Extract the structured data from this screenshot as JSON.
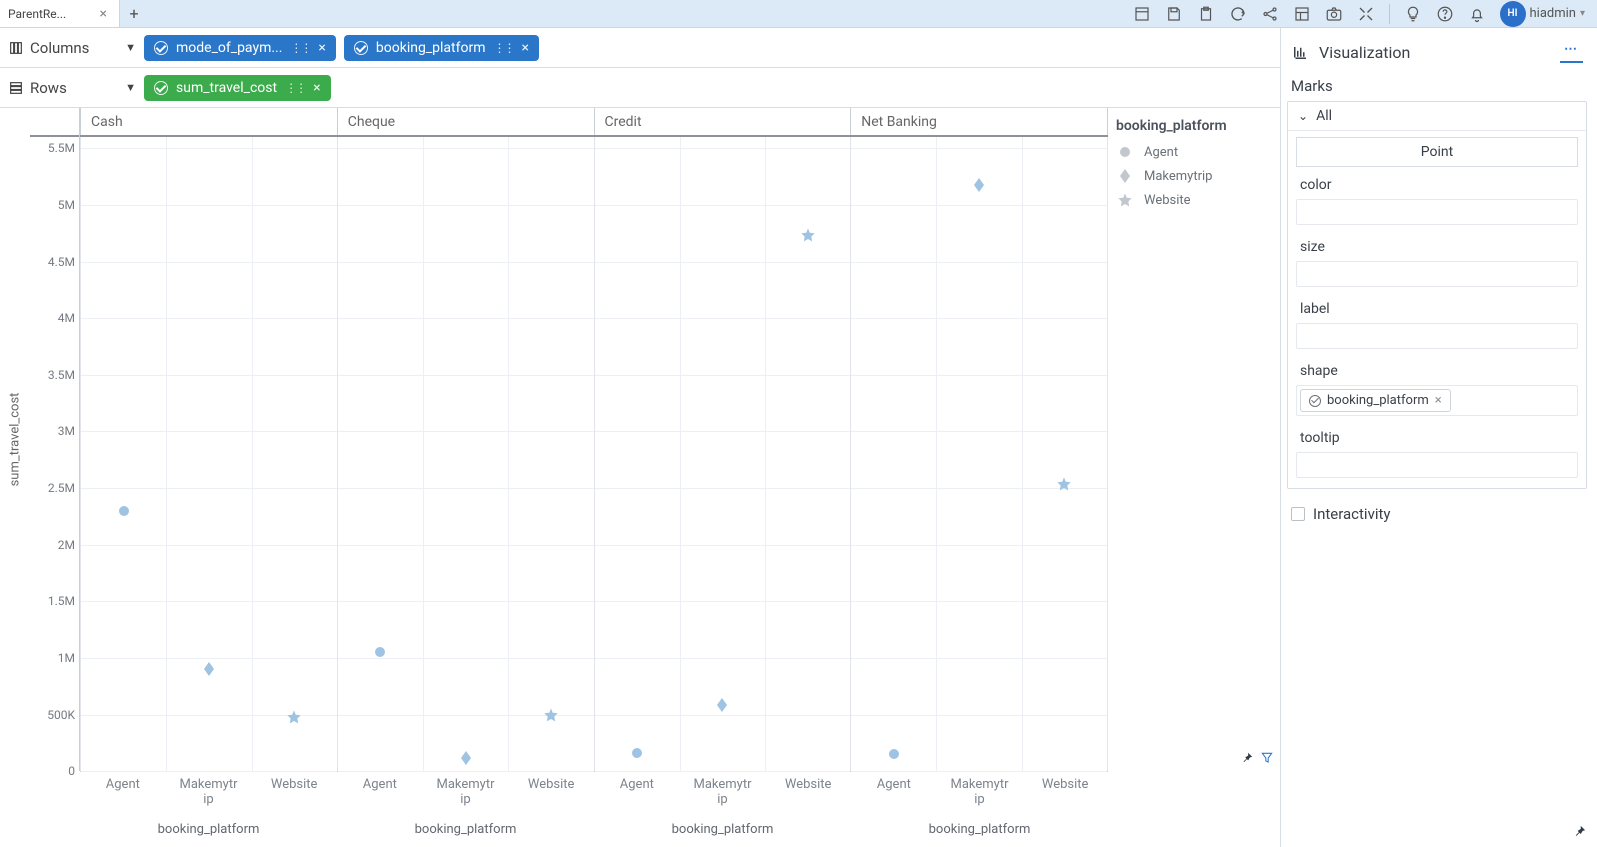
{
  "tab_title": "ParentRe...",
  "user_name": "hiadmin",
  "avatar_text": "HI",
  "shelves": {
    "columns_label": "Columns",
    "rows_label": "Rows",
    "col_pills": [
      {
        "label": "mode_of_paym..."
      },
      {
        "label": "booking_platform"
      }
    ],
    "row_pills": [
      {
        "label": "sum_travel_cost"
      }
    ]
  },
  "right": {
    "title": "Visualization",
    "marks": "Marks",
    "all": "All",
    "mark_type": "Point",
    "props": {
      "color": "color",
      "size": "size",
      "label": "label",
      "shape": "shape",
      "tooltip": "tooltip"
    },
    "shape_chip": "booking_platform",
    "interactivity": "Interactivity"
  },
  "legend": {
    "title": "booking_platform",
    "items": [
      "Agent",
      "Makemytrip",
      "Website"
    ]
  },
  "chart_data": {
    "type": "scatter",
    "ylabel": "sum_travel_cost",
    "ylim": [
      0,
      5600000
    ],
    "yticks": [
      0,
      500000,
      1000000,
      1500000,
      2000000,
      2500000,
      3000000,
      3500000,
      4000000,
      4500000,
      5000000,
      5500000
    ],
    "ytick_labels": [
      "0",
      "500K",
      "1M",
      "1.5M",
      "2M",
      "2.5M",
      "3M",
      "3.5M",
      "4M",
      "4.5M",
      "5M",
      "5.5M"
    ],
    "facet_field": "mode_of_payment",
    "facets": [
      "Cash",
      "Cheque",
      "Credit",
      "Net Banking"
    ],
    "x_field": "booking_platform",
    "x_categories": [
      "Agent",
      "Makemytrip",
      "Website"
    ],
    "x_category_labels": [
      "Agent",
      "Makemytrip",
      "Website"
    ],
    "xlabel": "booking_platform",
    "shape_field": "booking_platform",
    "shape_map": {
      "Agent": "circle",
      "Makemytrip": "diamond",
      "Website": "star"
    },
    "series": [
      {
        "facet": "Cash",
        "x": "Agent",
        "y": 2280000
      },
      {
        "facet": "Cash",
        "x": "Makemytrip",
        "y": 880000
      },
      {
        "facet": "Cash",
        "x": "Website",
        "y": 460000
      },
      {
        "facet": "Cheque",
        "x": "Agent",
        "y": 1030000
      },
      {
        "facet": "Cheque",
        "x": "Makemytrip",
        "y": 100000
      },
      {
        "facet": "Cheque",
        "x": "Website",
        "y": 480000
      },
      {
        "facet": "Credit",
        "x": "Agent",
        "y": 140000
      },
      {
        "facet": "Credit",
        "x": "Makemytrip",
        "y": 570000
      },
      {
        "facet": "Credit",
        "x": "Website",
        "y": 4720000
      },
      {
        "facet": "Net Banking",
        "x": "Agent",
        "y": 130000
      },
      {
        "facet": "Net Banking",
        "x": "Makemytrip",
        "y": 5160000
      },
      {
        "facet": "Net Banking",
        "x": "Website",
        "y": 2520000
      }
    ]
  },
  "colors": {
    "point": "#9fc3e2"
  }
}
